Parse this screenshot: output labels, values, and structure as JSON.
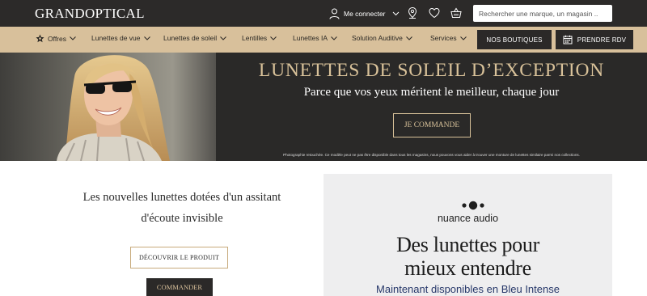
{
  "header": {
    "logo": "GRANDOPTICAL",
    "account_label": "Me connecter",
    "search_placeholder": "Rechercher une marque, un magasin .."
  },
  "nav": {
    "items": [
      {
        "label": "Offres",
        "icon": "star-badge-icon"
      },
      {
        "label": "Lunettes de vue"
      },
      {
        "label": "Lunettes de soleil"
      },
      {
        "label": "Lentilles"
      },
      {
        "label": "Lunettes IA"
      },
      {
        "label": "Solution Auditive"
      },
      {
        "label": "Services"
      }
    ],
    "stores_button": "NOS BOUTIQUES",
    "appointment_button": "PRENDRE RDV"
  },
  "hero": {
    "title": "LUNETTES DE SOLEIL D’EXCEPTION",
    "subtitle": "Parce que vos yeux méritent le meilleur, chaque jour",
    "cta": "JE COMMANDE",
    "disclaimer": "Photographie retouchée. Ce modèle peut ne pas être disponible dans tous les magasins, nous pouvons vous aider à trouver une monture de lunettes similaire parmi nos collections."
  },
  "promo": {
    "title_line1": "Les nouvelles lunettes dotées d'un assitant",
    "title_line2": "d'écoute invisible",
    "discover_button": "DÉCOUVRIR LE PRODUIT",
    "order_button": "COMMANDER"
  },
  "ad": {
    "brand": "nuance audio",
    "headline_line1": "Des lunettes pour",
    "headline_line2": "mieux entendre",
    "subline": "Maintenant disponibles en Bleu Intense"
  },
  "colors": {
    "topbar": "#2c2a29",
    "nav_gold": "#d8c09b",
    "accent_gold": "#d9c29a",
    "ad_blue": "#27386a"
  }
}
